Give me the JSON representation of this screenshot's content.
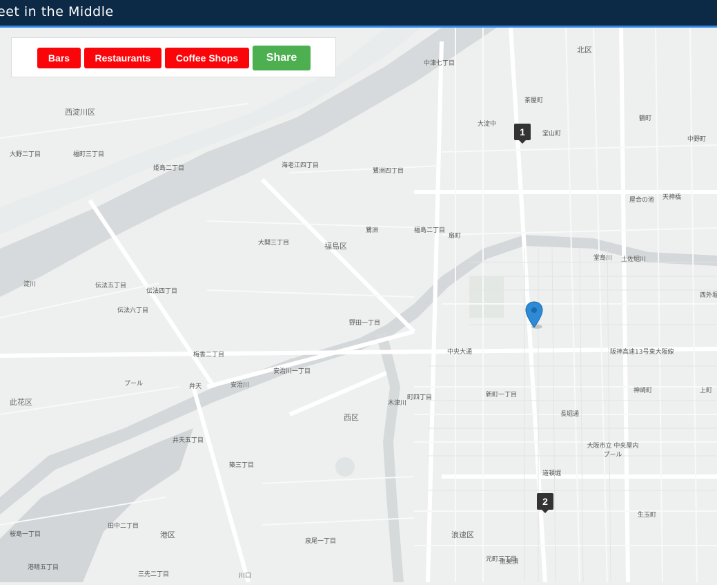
{
  "header": {
    "title": "eet in the Middle"
  },
  "toolbar": {
    "bars_label": "Bars",
    "restaurants_label": "Restaurants",
    "coffee_label": "Coffee Shops",
    "share_label": "Share"
  },
  "markers": {
    "m1": "1",
    "m2": "2",
    "center_pin": "location-pin-icon"
  },
  "colors": {
    "header": "#0c2946",
    "accent": "#2f86e6",
    "category_button": "#fa0509",
    "share_button": "#4caf50",
    "water": "#d7dadc",
    "land": "#eef0f0"
  },
  "map_labels": [
    "北区",
    "中津七丁目",
    "茶屋町",
    "大淀中",
    "堂山町",
    "鶴町",
    "中野町",
    "西淀川区",
    "大野二丁目",
    "福町三丁目",
    "姫島二丁目",
    "海老江四丁目",
    "鷺洲四丁目",
    "大開三丁目",
    "福島区",
    "鷺洲",
    "福島二丁目",
    "扇町",
    "屋合の池",
    "天神橋",
    "淀川",
    "伝法五丁目",
    "伝法四丁目",
    "伝法六丁目",
    "野田一丁目",
    "堂島川",
    "土佐堀川",
    "西外堀",
    "梅香二丁目",
    "安治川一丁目",
    "安治川",
    "プール",
    "此花区",
    "中央大通",
    "阪神高速13号東大阪線",
    "新町一丁目",
    "町四丁目",
    "木津川",
    "西区",
    "井天五丁目",
    "長堀通",
    "大阪市立 中央屋内 プール",
    "神崎町",
    "上町",
    "道頓堀",
    "生玉町",
    "浪速区",
    "港区",
    "田中二丁目",
    "桜島一丁目",
    "港晴五丁目",
    "三先二丁目",
    "恵美須",
    "泉尾一丁目",
    "元町三丁目",
    "築三丁目",
    "弁天",
    "川口"
  ]
}
